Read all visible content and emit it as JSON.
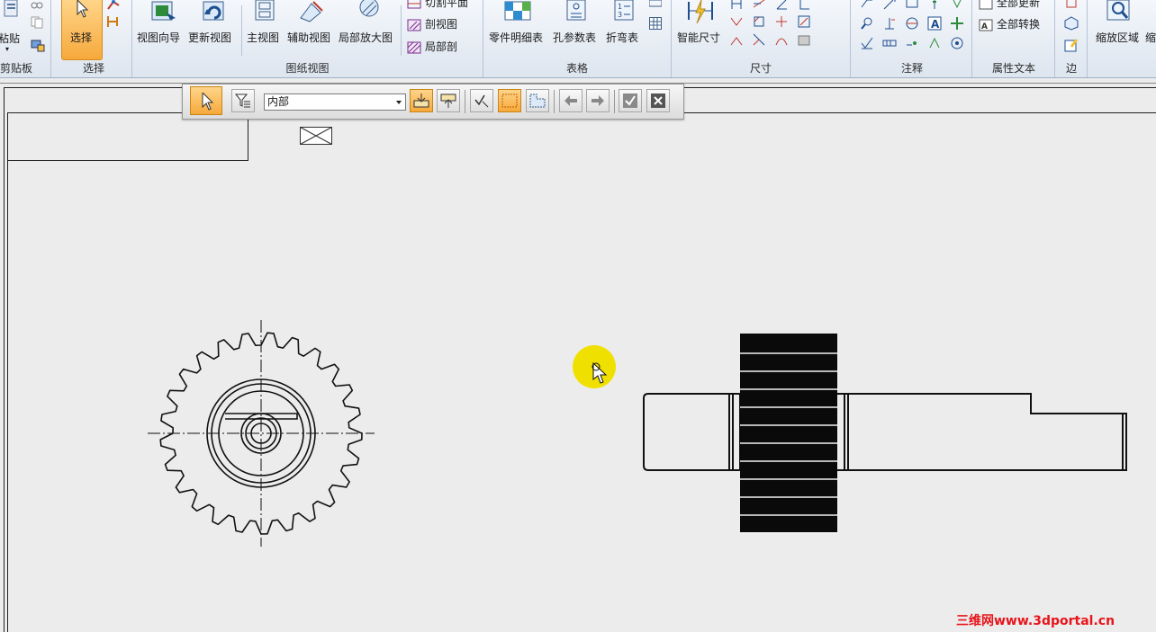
{
  "ribbon": {
    "clipboard": {
      "paste_label": "粘贴",
      "group_label": "剪贴板"
    },
    "select": {
      "select_label": "选择",
      "group_label": "选择"
    },
    "drawing_views": {
      "view_wizard": "视图向导",
      "update_views": "更新视图",
      "principal_view": "主视图",
      "auxiliary_view": "辅助视图",
      "detail_view": "局部放大图",
      "cutting_plane": "切割平面",
      "section_view": "剖视图",
      "broken_out": "局部剖",
      "group_label": "图纸视图"
    },
    "tables": {
      "parts_list": "零件明细表",
      "hole_table": "孔参数表",
      "bend_table": "折弯表",
      "group_label": "表格"
    },
    "dimension": {
      "smart_dimension": "智能尺寸",
      "group_label": "尺寸"
    },
    "annotation": {
      "group_label": "注释"
    },
    "property_text": {
      "update_all": "全部更新",
      "convert_all": "全部转换",
      "group_label": "属性文本"
    },
    "edge": {
      "group_label": "边"
    },
    "zoom": {
      "zoom_area": "缩放区域",
      "zoom_cut": "缩"
    }
  },
  "floating_toolbar": {
    "filter_value": "内部"
  },
  "watermark": {
    "text": "三维网www.3dportal.cn"
  },
  "colors": {
    "accent_orange": "#f6a93b",
    "watermark_red": "#e8141b",
    "highlight_yellow": "#f0e000"
  }
}
